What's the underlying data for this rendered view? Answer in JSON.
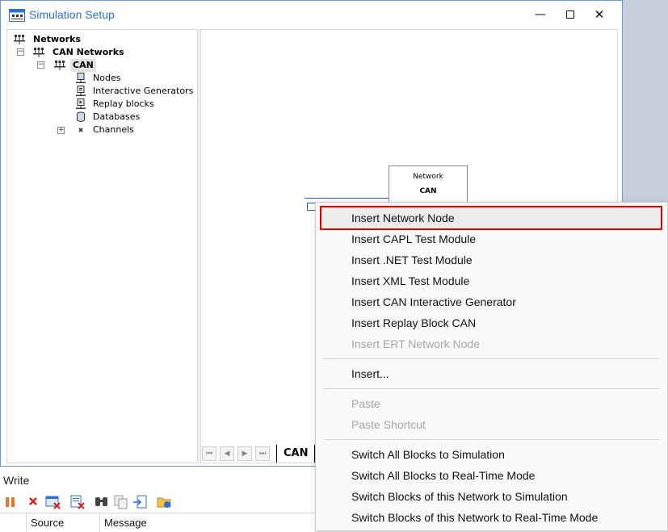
{
  "window": {
    "title": "Simulation Setup",
    "minimize_glyph": "—",
    "close_glyph": "✕"
  },
  "tree": {
    "root": "Networks",
    "can_networks": "CAN Networks",
    "network": "CAN",
    "children": [
      "Nodes",
      "Interactive Generators",
      "Replay blocks",
      "Databases",
      "Channels"
    ],
    "expand_glyph": "+",
    "collapse_glyph": "−"
  },
  "canvas": {
    "network_box_caption": "Network",
    "network_box_name": "CAN",
    "tab_label": "CAN"
  },
  "tab_nav": [
    "⏮",
    "◀",
    "▶",
    "⏭"
  ],
  "write": {
    "title": "Write",
    "columns": [
      "Source",
      "Message"
    ]
  },
  "context_menu": {
    "group1": [
      {
        "label": "Insert Network Node",
        "enabled": true,
        "highlighted": true
      },
      {
        "label": "Insert CAPL Test Module",
        "enabled": true
      },
      {
        "label": "Insert .NET Test Module",
        "enabled": true
      },
      {
        "label": "Insert XML Test Module",
        "enabled": true
      },
      {
        "label": "Insert CAN Interactive Generator",
        "enabled": true
      },
      {
        "label": "Insert Replay Block CAN",
        "enabled": true
      },
      {
        "label": "Insert ERT Network Node",
        "enabled": false
      }
    ],
    "group2": [
      {
        "label": "Insert...",
        "enabled": true
      }
    ],
    "group3": [
      {
        "label": "Paste",
        "enabled": false
      },
      {
        "label": "Paste Shortcut",
        "enabled": false
      }
    ],
    "group4": [
      {
        "label": "Switch All Blocks to Simulation",
        "enabled": true
      },
      {
        "label": "Switch All Blocks to Real-Time Mode",
        "enabled": true
      },
      {
        "label": "Switch Blocks of this Network to Simulation",
        "enabled": true
      },
      {
        "label": "Switch Blocks of this Network to Real-Time Mode",
        "enabled": true
      }
    ]
  },
  "colors": {
    "title_text": "#2e6fcf",
    "highlight_border": "#e00000",
    "disabled_text": "#a6a6a6",
    "bus_line": "#2060c0"
  }
}
